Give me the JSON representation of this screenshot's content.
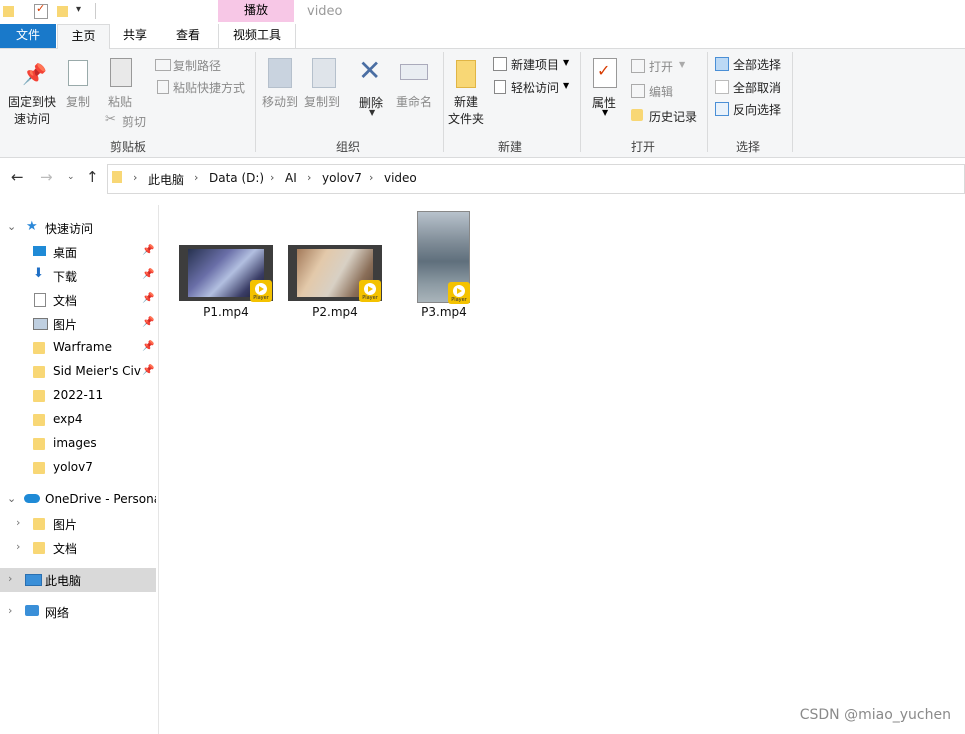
{
  "window": {
    "title": "video",
    "context_tab_header": "播放"
  },
  "ribbon_tabs": [
    {
      "label": "文件"
    },
    {
      "label": "主页"
    },
    {
      "label": "共享"
    },
    {
      "label": "查看"
    },
    {
      "label": "视频工具"
    }
  ],
  "ribbon": {
    "clipboard": {
      "pin_quick_access": "固定到快\n速访问",
      "pin_line1": "固定到快",
      "pin_line2": "速访问",
      "copy": "复制",
      "paste": "粘贴",
      "copy_path": "复制路径",
      "paste_shortcut": "粘贴快捷方式",
      "cut": "剪切",
      "group_label": "剪贴板"
    },
    "organize": {
      "move_to": "移动到",
      "copy_to": "复制到",
      "delete": "删除",
      "rename": "重命名",
      "group_label": "组织"
    },
    "new": {
      "new_folder_line1": "新建",
      "new_folder_line2": "文件夹",
      "new_item": "新建项目",
      "easy_access": "轻松访问",
      "group_label": "新建"
    },
    "open": {
      "properties": "属性",
      "open": "打开",
      "edit": "编辑",
      "history": "历史记录",
      "group_label": "打开"
    },
    "select": {
      "select_all": "全部选择",
      "select_none": "全部取消",
      "invert": "反向选择",
      "group_label": "选择"
    }
  },
  "address": {
    "crumbs": [
      "此电脑",
      "Data (D:)",
      "AI",
      "yolov7",
      "video"
    ]
  },
  "nav": {
    "quick_access": "快速访问",
    "items": [
      {
        "label": "桌面",
        "pinned": true
      },
      {
        "label": "下载",
        "pinned": true
      },
      {
        "label": "文档",
        "pinned": true
      },
      {
        "label": "图片",
        "pinned": true
      },
      {
        "label": "Warframe",
        "pinned": true
      },
      {
        "label": "Sid Meier's Civ",
        "pinned": true
      },
      {
        "label": "2022-11",
        "pinned": false
      },
      {
        "label": "exp4",
        "pinned": false
      },
      {
        "label": "images",
        "pinned": false
      },
      {
        "label": "yolov7",
        "pinned": false
      }
    ],
    "onedrive": "OneDrive - Persona",
    "onedrive_children": [
      "图片",
      "文档"
    ],
    "this_pc": "此电脑",
    "network": "网络"
  },
  "files": [
    {
      "name": "P1.mp4",
      "badge": "Player"
    },
    {
      "name": "P2.mp4",
      "badge": "Player"
    },
    {
      "name": "P3.mp4",
      "badge": "Player"
    }
  ],
  "watermark": "CSDN @miao_yuchen",
  "colors": {
    "file_tab": "#1979ca",
    "context_tab": "#f7c7e6",
    "selected_nav": "#d9d9d9",
    "folder": "#f8d775",
    "player_badge": "#f4c200"
  }
}
